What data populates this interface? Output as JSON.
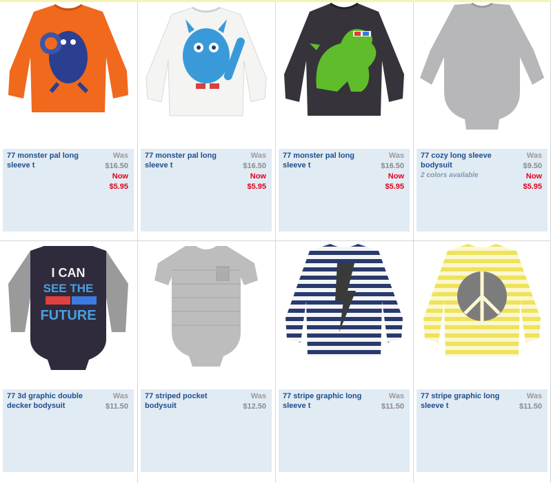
{
  "products": [
    {
      "name": "77 monster pal long sleeve t",
      "was_label": "Was",
      "was": "$16.50",
      "now_label": "Now",
      "now": "$5.95",
      "colors": ""
    },
    {
      "name": "77 monster pal long sleeve t",
      "was_label": "Was",
      "was": "$16.50",
      "now_label": "Now",
      "now": "$5.95",
      "colors": ""
    },
    {
      "name": "77 monster pal long sleeve t",
      "was_label": "Was",
      "was": "$16.50",
      "now_label": "Now",
      "now": "$5.95",
      "colors": ""
    },
    {
      "name": "77 cozy long sleeve bodysuit",
      "was_label": "Was",
      "was": "$9.50",
      "now_label": "Now",
      "now": "$5.95",
      "colors": "2 colors available"
    },
    {
      "name": "77 3d graphic double decker bodysuit",
      "was_label": "Was",
      "was": "$11.50",
      "now_label": "",
      "now": "",
      "colors": ""
    },
    {
      "name": "77 striped pocket bodysuit",
      "was_label": "Was",
      "was": "$12.50",
      "now_label": "",
      "now": "",
      "colors": ""
    },
    {
      "name": "77 stripe graphic long sleeve t",
      "was_label": "Was",
      "was": "$11.50",
      "now_label": "",
      "now": "",
      "colors": ""
    },
    {
      "name": "77 stripe graphic long sleeve t",
      "was_label": "Was",
      "was": "$11.50",
      "now_label": "",
      "now": "",
      "colors": ""
    }
  ],
  "graphics": {
    "shirt3_text": "I CAN SEE THE FUTURE"
  },
  "colors": {
    "link": "#1f4e8c",
    "sale": "#e2001a",
    "info_bg": "#e1ebf4"
  }
}
